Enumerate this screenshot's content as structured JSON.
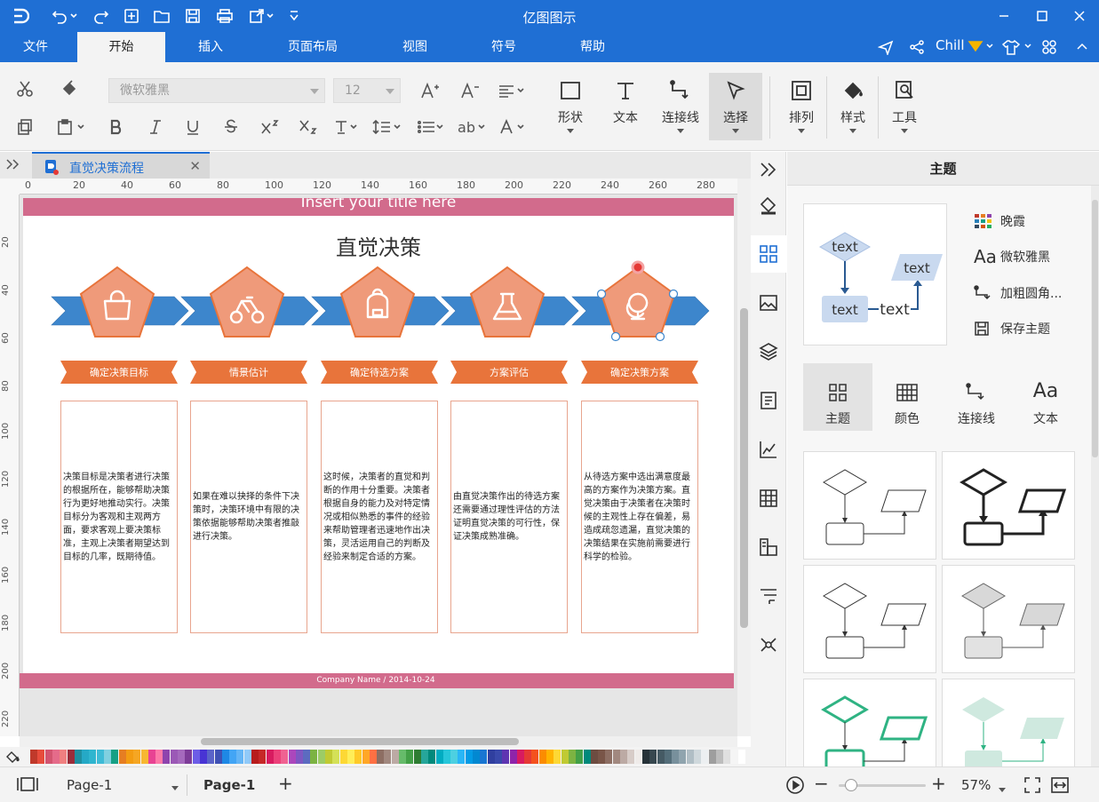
{
  "app": {
    "title": "亿图图示"
  },
  "menu": {
    "tabs": [
      "文件",
      "开始",
      "插入",
      "页面布局",
      "视图",
      "符号",
      "帮助"
    ],
    "active": "开始",
    "user": "Chill"
  },
  "ribbon": {
    "font_name": "微软雅黑",
    "font_size": "12",
    "shape_label": "形状",
    "text_label": "文本",
    "connector_label": "连接线",
    "select_label": "选择",
    "arrange_label": "排列",
    "style_label": "样式",
    "tools_label": "工具"
  },
  "doc": {
    "tab_name": "直觉决策流程"
  },
  "ruler": {
    "top": [
      "0",
      "20",
      "40",
      "60",
      "80",
      "100",
      "120",
      "140",
      "160",
      "180",
      "200",
      "220",
      "240",
      "260",
      "280"
    ],
    "left": [
      "20",
      "40",
      "60",
      "80",
      "100",
      "120",
      "140",
      "160",
      "180",
      "200",
      "220"
    ]
  },
  "diagram": {
    "header": "Insert your title here",
    "title": "直觉决策",
    "footer": "Company Name / 2014-10-24",
    "steps": [
      {
        "label": "确定决策目标",
        "icon": "shopping-bag-icon",
        "text": "决策目标是决策者进行决策的根据所在，能够帮助决策行为更好地推动实行。决策目标分为客观和主观两方面，要求客观上要决策标准，主观上决策者期望达到目标的几率，既期待值。"
      },
      {
        "label": "情景估计",
        "icon": "bicycle-icon",
        "text": "如果在难以抉择的条件下决策时，决策环境中有限的决策依据能够帮助决策者推敲进行决策。"
      },
      {
        "label": "确定待选方案",
        "icon": "backpack-icon",
        "text": "这时候，决策者的直觉和判断的作用十分重要。决策者根据自身的能力及对特定情况或相似熟悉的事件的经验来帮助管理者迅速地作出决策，灵活运用自己的判断及经验来制定合适的方案。"
      },
      {
        "label": "方案评估",
        "icon": "flask-icon",
        "text": "由直觉决策作出的待选方案还需要通过理性评估的方法证明直觉决策的可行性，保证决策成熟准确。"
      },
      {
        "label": "确定决策方案",
        "icon": "globe-icon",
        "text": "从待选方案中选出满意度最高的方案作为决策方案。直觉决策由于决策者在决策时候的主观性上存在偏差，易造成疏忽遗漏，直觉决策的决策结果在实施前需要进行科学的检验。"
      }
    ]
  },
  "panel": {
    "title": "主题",
    "preview_texts": [
      "text",
      "text",
      "text",
      "text"
    ],
    "options": [
      "晚霞",
      "微软雅黑",
      "加粗圆角...",
      "保存主题"
    ],
    "tabs": [
      "主题",
      "颜色",
      "连接线",
      "文本"
    ]
  },
  "status": {
    "page_dropdown": "Page-1",
    "page_tab": "Page-1",
    "zoom": "57%"
  },
  "colors": {
    "accent": "#1f6fd4",
    "orange": "#e8743b",
    "pentagon": "#ef9a7a",
    "arrow": "#3d86cc",
    "band": "#d26b8c"
  },
  "palette": [
    "#c0392b",
    "#e74c3c",
    "#d35470",
    "#e56b8a",
    "#f08080",
    "#9b2d3a",
    "#1f8fa0",
    "#25a9c6",
    "#2fb5cf",
    "#3ebbd6",
    "#7fd0e0",
    "#16a085",
    "#e67e22",
    "#f39c12",
    "#f5a623",
    "#f7b731",
    "#e84393",
    "#fd79a8",
    "#8e44ad",
    "#9b59b6",
    "#a569bd",
    "#7d3c98",
    "#6c5ce7",
    "#4834d4",
    "#5a63c9",
    "#3f51b5",
    "#1e88e5",
    "#42a5f5",
    "#64b5f6",
    "#90caf9",
    "#b71c1c",
    "#c62828",
    "#d81b60",
    "#ec407a",
    "#f06292",
    "#ab47bc",
    "#7e57c2",
    "#5c6bc0",
    "#7cb342",
    "#9ccc65",
    "#c0ca33",
    "#d4e157",
    "#fdd835",
    "#ffee58",
    "#ffca28",
    "#ffa726",
    "#ff7043",
    "#8d6e63",
    "#a1887f",
    "#bcaaa4",
    "#66bb6a",
    "#43a047",
    "#2e7d32",
    "#26a69a",
    "#00897b",
    "#00acc1",
    "#26c6da",
    "#4dd0e1",
    "#29b6f6",
    "#039be5",
    "#0288d1",
    "#1976d2",
    "#303f9f",
    "#3949ab",
    "#5e35b1",
    "#8e24aa",
    "#d81b60",
    "#e53935",
    "#f4511e",
    "#fb8c00",
    "#ffb300",
    "#fdd835",
    "#c0ca33",
    "#7cb342",
    "#43a047",
    "#00897b",
    "#6d4c41",
    "#795548",
    "#8d6e63",
    "#a1887f",
    "#bcaaa4",
    "#d7ccc8",
    "#efebe9",
    "#263238",
    "#37474f",
    "#455a64",
    "#546e7a",
    "#78909c",
    "#90a4ae",
    "#b0bec5",
    "#cfd8dc",
    "#eceff1",
    "#9e9e9e",
    "#bdbdbd",
    "#e0e0e0",
    "#f5f5f5",
    "#ffffff"
  ]
}
